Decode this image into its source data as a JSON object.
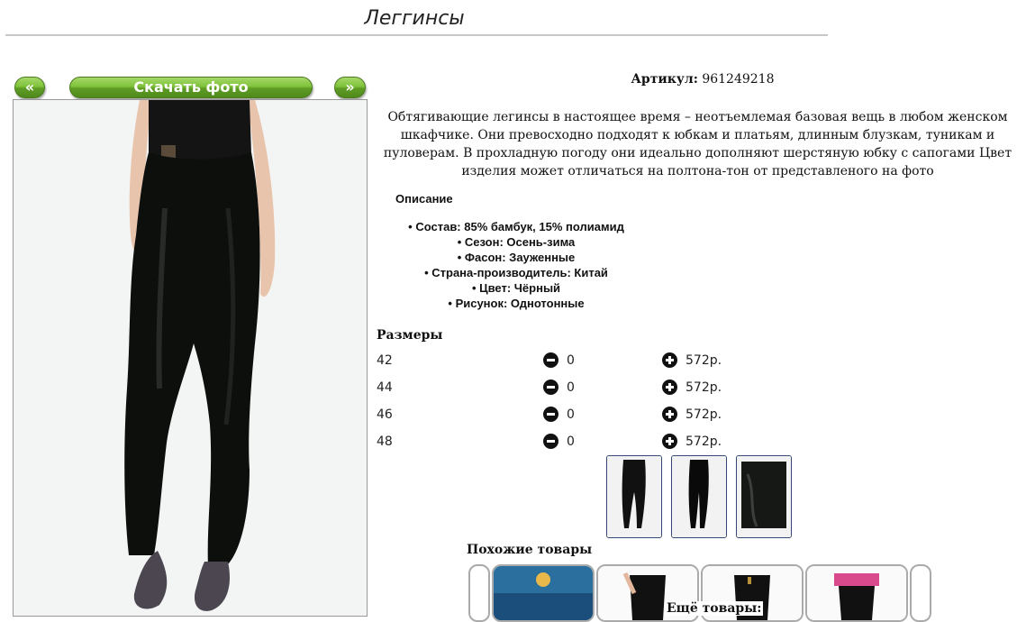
{
  "page": {
    "title": "Леггинсы"
  },
  "gallery": {
    "prev_label": "«",
    "download_label": "Скачать фото",
    "next_label": "»"
  },
  "product": {
    "article_label": "Артикул:",
    "article_value": "961249218",
    "description": "Обтягивающие легинсы в настоящее время – неотъемлемая базовая вещь в любом женском шкафчике. Они превосходно подходят к юбкам и платьям, длинным блузкам, туникам и пуловерам. В прохладную погоду они идеально дополняют шерстяную юбку с сапогами Цвет изделия может отличаться на полтона-тон от представленого на фото",
    "details_heading": "Описание",
    "properties": [
      "Состав: 85% бамбук, 15% полиамид",
      "Сезон: Осень-зима",
      "Фасон: Зауженные",
      "Страна-производитель: Китай",
      "Цвет: Чёрный",
      "Рисунок: Однотонные"
    ]
  },
  "sizes": {
    "heading": "Размеры",
    "rows": [
      {
        "size": "42",
        "qty": "0",
        "price": "572р."
      },
      {
        "size": "44",
        "qty": "0",
        "price": "572р."
      },
      {
        "size": "46",
        "qty": "0",
        "price": "572р."
      },
      {
        "size": "48",
        "qty": "0",
        "price": "572р."
      }
    ]
  },
  "similar": {
    "heading": "Похожие товары",
    "more_heading": "Ещё товары:"
  },
  "icons": {
    "minus": "minus-circle-icon",
    "plus": "plus-circle-icon"
  },
  "colors": {
    "button_green": "#6cae2e",
    "thumb_border": "#334a7a"
  }
}
